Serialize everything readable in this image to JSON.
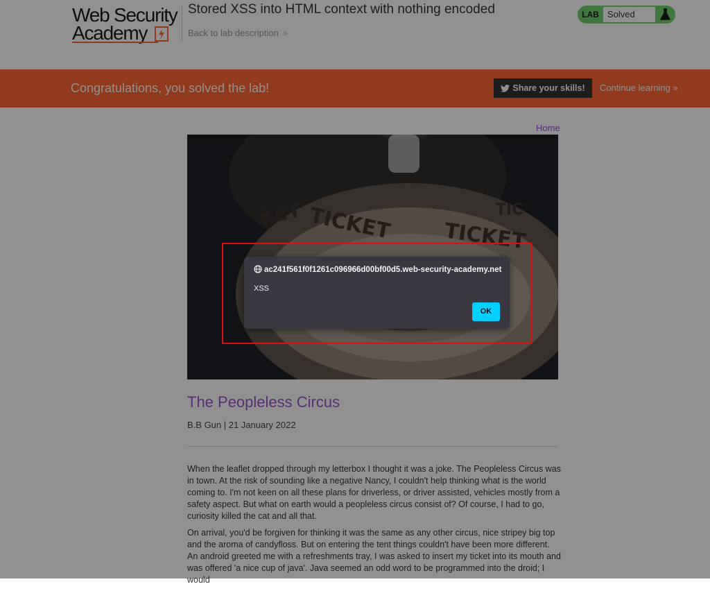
{
  "header": {
    "logo_line1": "Web Security",
    "logo_line2": "Academy",
    "lab_title": "Stored XSS into HTML context with nothing encoded",
    "back_link": "Back to lab description",
    "lab_badge": "LAB",
    "lab_state": "Solved"
  },
  "banner": {
    "message": "Congratulations, you solved the lab!",
    "share_label": "Share your skills!",
    "continue_label": "Continue learning"
  },
  "nav": {
    "home": "Home"
  },
  "post": {
    "title": "The Peopleless Circus",
    "meta": "B.B Gun | 21 January 2022",
    "paragraphs": [
      "When the leaflet dropped through my letterbox I thought it was a joke. The Peopleless Circus was in town. At the risk of sounding like a negative Nancy, I couldn't help thinking what is the world coming to. I'm not keen on all these plans for driverless, or driver assisted, vehicles mostly from a safety aspect. But what on earth would a peopleless circus consist of? Of course, I had to go, curiosity killed the cat and all that.",
      "On arrival, you'd be forgiven for thinking it was the same as any other circus, nice stripey big top and the aroma of candyfloss. But on entering the tent things couldn't have been more different. An android greeted me with a refreshments tray, I was asked to insert my ticket into its mouth and was offered 'a nice cup of java'. Java seemed an odd word to be programmed into the droid; I would"
    ]
  },
  "dialog": {
    "origin": "ac241f561f0f1261c096966d00bf00d5.web-security-academy.net",
    "message": "XSS",
    "ok_label": "OK"
  },
  "colors": {
    "accent": "#ff6633",
    "link_purple": "#9a54c9",
    "solved_green": "#70d16d",
    "dialog_button": "#00cfff"
  },
  "icons": [
    "lightning-bolt-icon",
    "flask-icon",
    "twitter-icon",
    "chevron-right-icon",
    "globe-icon"
  ]
}
